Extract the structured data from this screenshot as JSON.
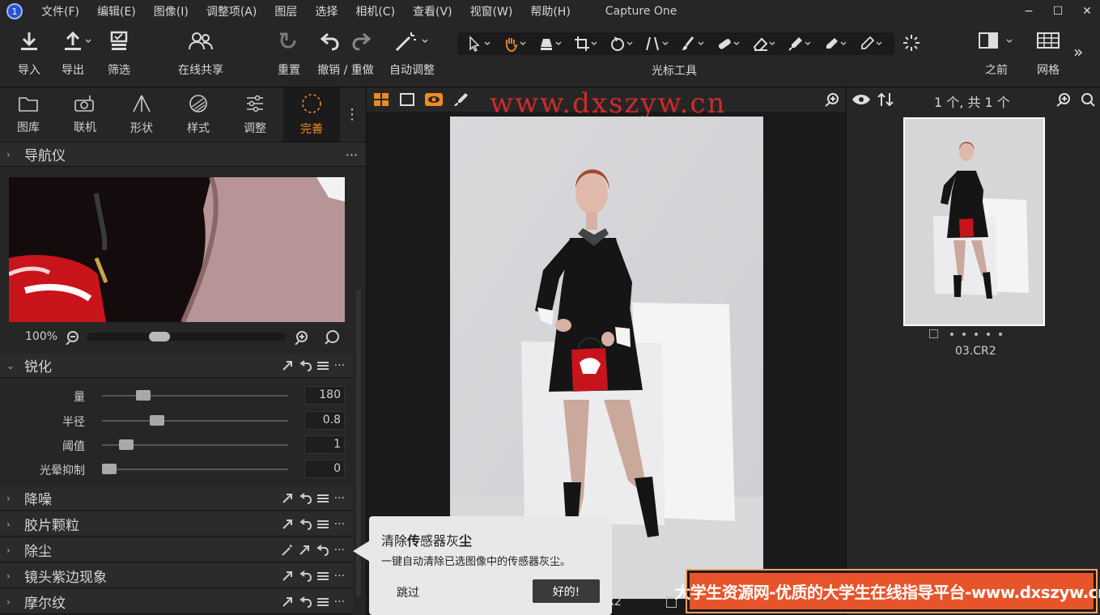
{
  "app": {
    "title": "Capture One",
    "logo_text": "1"
  },
  "menu": [
    "文件(F)",
    "编辑(E)",
    "图像(I)",
    "调整项(A)",
    "图层",
    "选择",
    "相机(C)",
    "查看(V)",
    "视窗(W)",
    "帮助(H)"
  ],
  "window_controls": {
    "minimize": "−",
    "maximize": "☐",
    "close": "✕"
  },
  "toolbar": {
    "import": "导入",
    "export": "导出",
    "filter": "筛选",
    "share": "在线共享",
    "reset": "重置",
    "undo_redo": "撤销 / 重做",
    "auto_adjust": "自动调整",
    "cursor_tools": "光标工具",
    "before": "之前",
    "grid": "网格",
    "more": "»"
  },
  "tool_tabs": [
    "图库",
    "联机",
    "形状",
    "样式",
    "调整",
    "完善"
  ],
  "navigator": {
    "title": "导航仪",
    "zoom": "100%",
    "zoom_level_fraction": 0.35
  },
  "sharpen": {
    "title": "锐化",
    "sliders": [
      {
        "label": "量",
        "value": "180",
        "fraction": 0.2
      },
      {
        "label": "半径",
        "value": "0.8",
        "fraction": 0.28
      },
      {
        "label": "阈值",
        "value": "1",
        "fraction": 0.1
      },
      {
        "label": "光晕抑制",
        "value": "0",
        "fraction": 0.0
      }
    ]
  },
  "sections": [
    "降噪",
    "胶片颗粒",
    "除尘",
    "镜头紫边现象",
    "摩尔纹"
  ],
  "viewer": {
    "filename": "R2",
    "watermark": "www.dxszyw.cn"
  },
  "browser": {
    "count": "1 个, 共 1 个",
    "thumb_name": "03.CR2"
  },
  "tooltip": {
    "title_pre": "清除",
    "title_bold": "传",
    "title_mid": "感器灰",
    "title_bold2": "尘",
    "body": "一键自动清除已选图像中的传感器灰尘。",
    "skip": "跳过",
    "ok": "好的!"
  },
  "banner": "大学生资源网-优质的大学生在线指导平台-www.dxszyw.cn",
  "colors": {
    "accent": "#f08a24",
    "banner": "#e8542a",
    "watermark": "#cf2a2a"
  }
}
